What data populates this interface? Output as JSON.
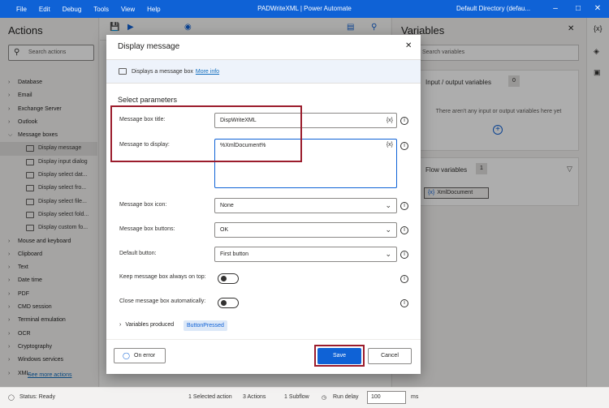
{
  "titlebar": {
    "menu": [
      "File",
      "Edit",
      "Debug",
      "Tools",
      "View",
      "Help"
    ],
    "title": "PADWriteXML | Power Automate",
    "account": "Default Directory (defau..."
  },
  "actions_panel": {
    "title": "Actions",
    "search_placeholder": "Search actions",
    "items": [
      {
        "label": "Database",
        "type": "cat",
        "chevron": ">"
      },
      {
        "label": "Email",
        "type": "cat",
        "chevron": ">"
      },
      {
        "label": "Exchange Server",
        "type": "cat",
        "chevron": ">"
      },
      {
        "label": "Outlook",
        "type": "cat",
        "chevron": ">"
      },
      {
        "label": "Message boxes",
        "type": "cat",
        "chevron": "v"
      },
      {
        "label": "Display message",
        "type": "sub",
        "selected": true
      },
      {
        "label": "Display input dialog",
        "type": "sub"
      },
      {
        "label": "Display select dat...",
        "type": "sub"
      },
      {
        "label": "Display select fro...",
        "type": "sub"
      },
      {
        "label": "Display select file...",
        "type": "sub"
      },
      {
        "label": "Display select fold...",
        "type": "sub"
      },
      {
        "label": "Display custom fo...",
        "type": "sub"
      },
      {
        "label": "Mouse and keyboard",
        "type": "cat",
        "chevron": ">"
      },
      {
        "label": "Clipboard",
        "type": "cat",
        "chevron": ">"
      },
      {
        "label": "Text",
        "type": "cat",
        "chevron": ">"
      },
      {
        "label": "Date time",
        "type": "cat",
        "chevron": ">"
      },
      {
        "label": "PDF",
        "type": "cat",
        "chevron": ">"
      },
      {
        "label": "CMD session",
        "type": "cat",
        "chevron": ">"
      },
      {
        "label": "Terminal emulation",
        "type": "cat",
        "chevron": ">"
      },
      {
        "label": "OCR",
        "type": "cat",
        "chevron": ">"
      },
      {
        "label": "Cryptography",
        "type": "cat",
        "chevron": ">"
      },
      {
        "label": "Windows services",
        "type": "cat",
        "chevron": ">"
      },
      {
        "label": "XML",
        "type": "cat",
        "chevron": ">"
      }
    ],
    "see_more": "See more actions"
  },
  "variables_panel": {
    "title": "Variables",
    "search_placeholder": "Search variables",
    "io_header": "Input / output variables",
    "io_count": "0",
    "io_empty": "There aren't any input or output variables here yet",
    "flow_header": "Flow variables",
    "flow_count": "1",
    "flow_var_icon": "{x}",
    "flow_var": "XmlDocument"
  },
  "status_bar": {
    "status": "Status: Ready",
    "selected": "1 Selected action",
    "actions": "3 Actions",
    "subflow": "1 Subflow",
    "run_delay_label": "Run delay",
    "run_delay_value": "100",
    "unit": "ms"
  },
  "dialog": {
    "title": "Display message",
    "info_text": "Displays a message box",
    "more_info": "More info",
    "section": "Select parameters",
    "title_label": "Message box title:",
    "title_value": "DispWriteXML",
    "message_label": "Message to display:",
    "message_value": "%XmlDocument%",
    "var_button": "{x}",
    "icon_label": "Message box icon:",
    "icon_value": "None",
    "buttons_label": "Message box buttons:",
    "buttons_value": "OK",
    "default_label": "Default button:",
    "default_value": "First button",
    "ontop_label": "Keep message box always on top:",
    "ontop_on": false,
    "autoclose_label": "Close message box automatically:",
    "autoclose_on": false,
    "vars_produced": "Variables produced",
    "produced_var": "ButtonPressed",
    "on_error": "On error",
    "save": "Save",
    "cancel": "Cancel"
  },
  "colors": {
    "accent": "#0f62d6",
    "annotation": "#9b1c2c"
  }
}
